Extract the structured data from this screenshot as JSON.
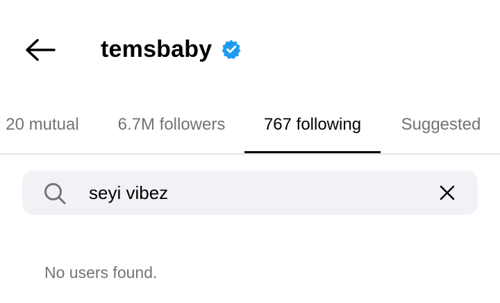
{
  "header": {
    "back_icon": "arrow-left-icon",
    "username": "temsbaby",
    "verified_icon": "verified-badge-icon",
    "verified_color": "#1d9bf0"
  },
  "tabs": [
    {
      "label": "20 mutual",
      "active": false
    },
    {
      "label": "6.7M followers",
      "active": false
    },
    {
      "label": "767 following",
      "active": true
    },
    {
      "label": "Suggested",
      "active": false
    }
  ],
  "search": {
    "icon": "search-icon",
    "value": "seyi vibez",
    "clear_icon": "close-icon",
    "background": "#f0f2f5"
  },
  "results": {
    "empty_message": "No users found."
  },
  "colors": {
    "text_primary": "#000000",
    "text_secondary": "#737373",
    "divider": "#e4e4e4"
  }
}
